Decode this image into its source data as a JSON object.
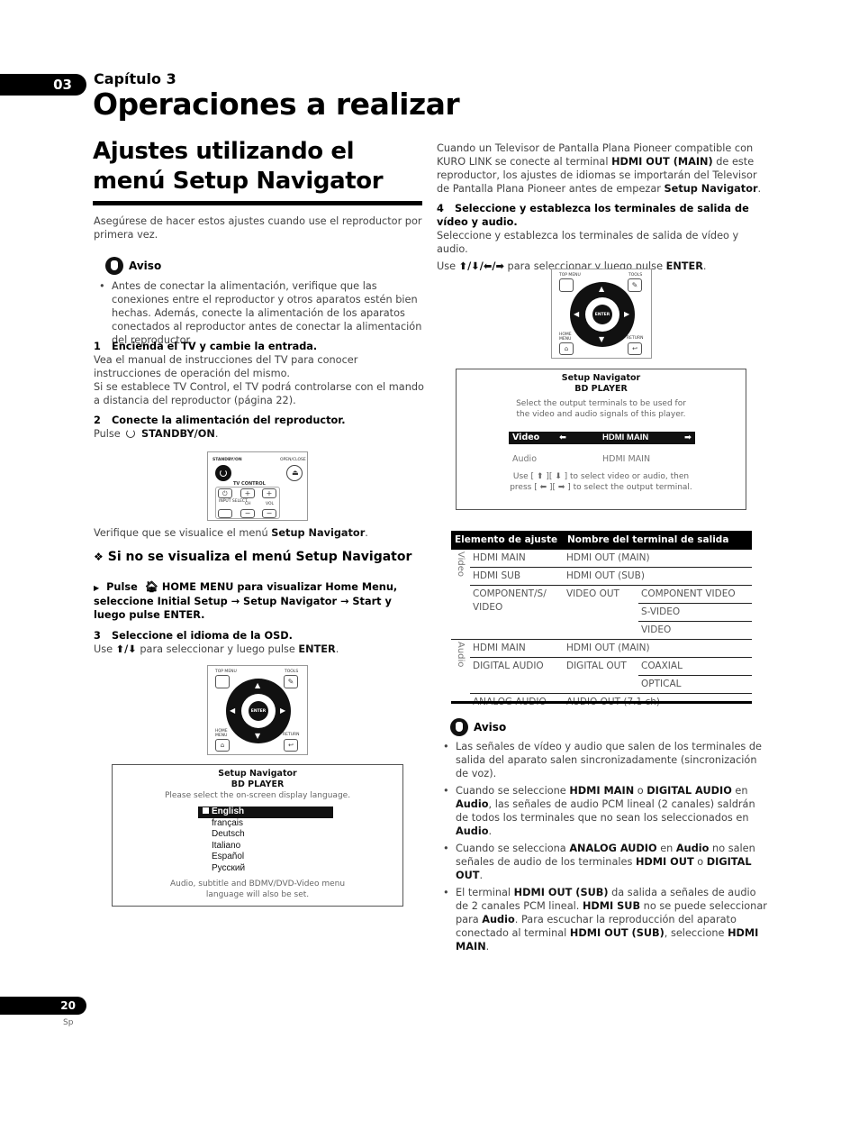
{
  "header": {
    "chapter_number": "03",
    "chapter_label": "Capítulo 3",
    "page_title": "Operaciones a realizar"
  },
  "section": {
    "title": "Ajustes utilizando el menú Setup Navigator",
    "intro": "Asegúrese de hacer estos ajustes cuando use el reproductor por primera vez."
  },
  "aviso1": {
    "label": "Aviso",
    "bullet": "Antes de conectar la alimentación, verifique que las conexiones entre el reproductor y otros aparatos estén bien hechas. Además, conecte la alimentación de los aparatos conectados al reproductor antes de conectar la alimentación del reproductor."
  },
  "step1": {
    "num": "1",
    "title": "Encienda el TV y cambie la entrada.",
    "body1": "Vea el manual de instrucciones del TV para conocer instrucciones de operación del mismo.",
    "body2": "Si se establece TV Control, el TV podrá controlarse con el mando a distancia del reproductor (página 22)."
  },
  "step2": {
    "num": "2",
    "title": "Conecte la alimentación del reproductor.",
    "pre": "Pulse",
    "icon": "power-icon",
    "key": "STANDBY/ON",
    "post": "."
  },
  "remote_power": {
    "standby_label": "STANDBY/ON",
    "open_close_label": "OPEN/CLOSE",
    "tv_control_label": "TV CONTROL",
    "input_select_label": "INPUT SELECT",
    "ch_label": "CH",
    "vol_label": "VOL"
  },
  "verify": {
    "pre": "Verifique que se visualice el menú ",
    "bold": "Setup Navigator",
    "post": "."
  },
  "subsection": {
    "icon": "diamond-bullet-icon",
    "title": "Si no se visualiza el menú Setup Navigator",
    "instruction_pre": "Pulse",
    "instruction_post": "HOME MENU para visualizar Home Menu, seleccione Initial Setup → Setup Navigator → Start y luego pulse ENTER."
  },
  "step3": {
    "num": "3",
    "title": "Seleccione el idioma de la OSD.",
    "pre": "Use ",
    "arrows": "⬆/⬇",
    "mid": " para seleccionar y luego pulse ",
    "key": "ENTER",
    "post": "."
  },
  "remote_nav": {
    "top_menu_label": "TOP MENU",
    "tools_label": "TOOLS",
    "enter_label": "ENTER",
    "home_menu_label": "HOME MENU",
    "return_label": "RETURN"
  },
  "osd_language": {
    "title": "Setup Navigator",
    "subtitle": "BD PLAYER",
    "prompt": "Please select the on-screen display language.",
    "options": [
      "English",
      "français",
      "Deutsch",
      "Italiano",
      "Español",
      "Русский"
    ],
    "selected": "English",
    "note1": "Audio, subtitle and BDMV/DVD-Video menu",
    "note2": "language will also be set."
  },
  "kuro": {
    "t1": "Cuando un Televisor de Pantalla Plana Pioneer compatible con KURO LINK se conecte al terminal ",
    "b1": "HDMI OUT (MAIN)",
    "t2": " de este reproductor, los ajustes de idiomas se importarán del Televisor de Pantalla Plana Pioneer antes de empezar ",
    "b2": "Setup Navigator",
    "t3": "."
  },
  "step4": {
    "num": "4",
    "title": "Seleccione y establezca los terminales de salida de vídeo y audio.",
    "body": "Seleccione y establezca los terminales de salida de vídeo y audio.",
    "pre": "Use ",
    "arrows": "⬆/⬇/⬅/➡",
    "mid": " para seleccionar y luego pulse ",
    "key": "ENTER",
    "post": "."
  },
  "osd_output": {
    "title": "Setup Navigator",
    "subtitle": "BD PLAYER",
    "prompt1": "Select the output terminals to be used for",
    "prompt2": "the video and audio signals of this player.",
    "video_label": "Video",
    "video_value": "HDMI MAIN",
    "audio_label": "Audio",
    "audio_value": "HDMI MAIN",
    "help1": "Use [ ⬆ ][ ⬇ ] to select video or audio, then",
    "help2": "press [ ⬅ ][ ➡ ] to select the output terminal."
  },
  "table": {
    "headers": [
      "Elemento de ajuste",
      "Nombre del terminal de salida"
    ],
    "groups": {
      "video": "Video",
      "audio": "Audio"
    },
    "rows": [
      {
        "item": "HDMI MAIN",
        "terminal": "HDMI OUT (MAIN)",
        "sub": ""
      },
      {
        "item": "HDMI SUB",
        "terminal": "HDMI OUT (SUB)",
        "sub": ""
      },
      {
        "item": "COMPONENT/S/ VIDEO",
        "terminal": "VIDEO OUT",
        "sub": "COMPONENT VIDEO"
      },
      {
        "item": "",
        "terminal": "",
        "sub": "S-VIDEO"
      },
      {
        "item": "",
        "terminal": "",
        "sub": "VIDEO"
      },
      {
        "item": "HDMI MAIN",
        "terminal": "HDMI OUT (MAIN)",
        "sub": ""
      },
      {
        "item": "DIGITAL AUDIO",
        "terminal": "DIGITAL OUT",
        "sub": "COAXIAL"
      },
      {
        "item": "",
        "terminal": "",
        "sub": "OPTICAL"
      },
      {
        "item": "ANALOG AUDIO",
        "terminal": "AUDIO OUT (7.1 ch)",
        "sub": ""
      }
    ]
  },
  "aviso2": {
    "label": "Aviso",
    "b1": "Las señales de vídeo y audio que salen de los terminales de salida del aparato salen sincronizadamente (sincronización de voz).",
    "b2": [
      "Cuando se seleccione ",
      "HDMI MAIN",
      " o ",
      "DIGITAL AUDIO",
      " en ",
      "Audio",
      ", las señales de audio PCM lineal (2 canales) saldrán de todos los terminales que no sean los seleccionados en ",
      "Audio",
      "."
    ],
    "b3": [
      "Cuando se selecciona ",
      "ANALOG AUDIO",
      " en ",
      "Audio",
      " no salen señales de audio de los terminales ",
      "HDMI OUT",
      " o ",
      "DIGITAL OUT",
      "."
    ],
    "b4": [
      "El terminal ",
      "HDMI OUT (SUB)",
      " da salida a señales de audio de 2 canales PCM lineal. ",
      "HDMI SUB",
      " no se puede seleccionar para ",
      "Audio",
      ". Para escuchar la reproducción del aparato conectado al terminal ",
      "HDMI OUT (SUB)",
      ", seleccione ",
      "HDMI MAIN",
      "."
    ]
  },
  "footer": {
    "page_number": "20",
    "lang": "Sp"
  }
}
